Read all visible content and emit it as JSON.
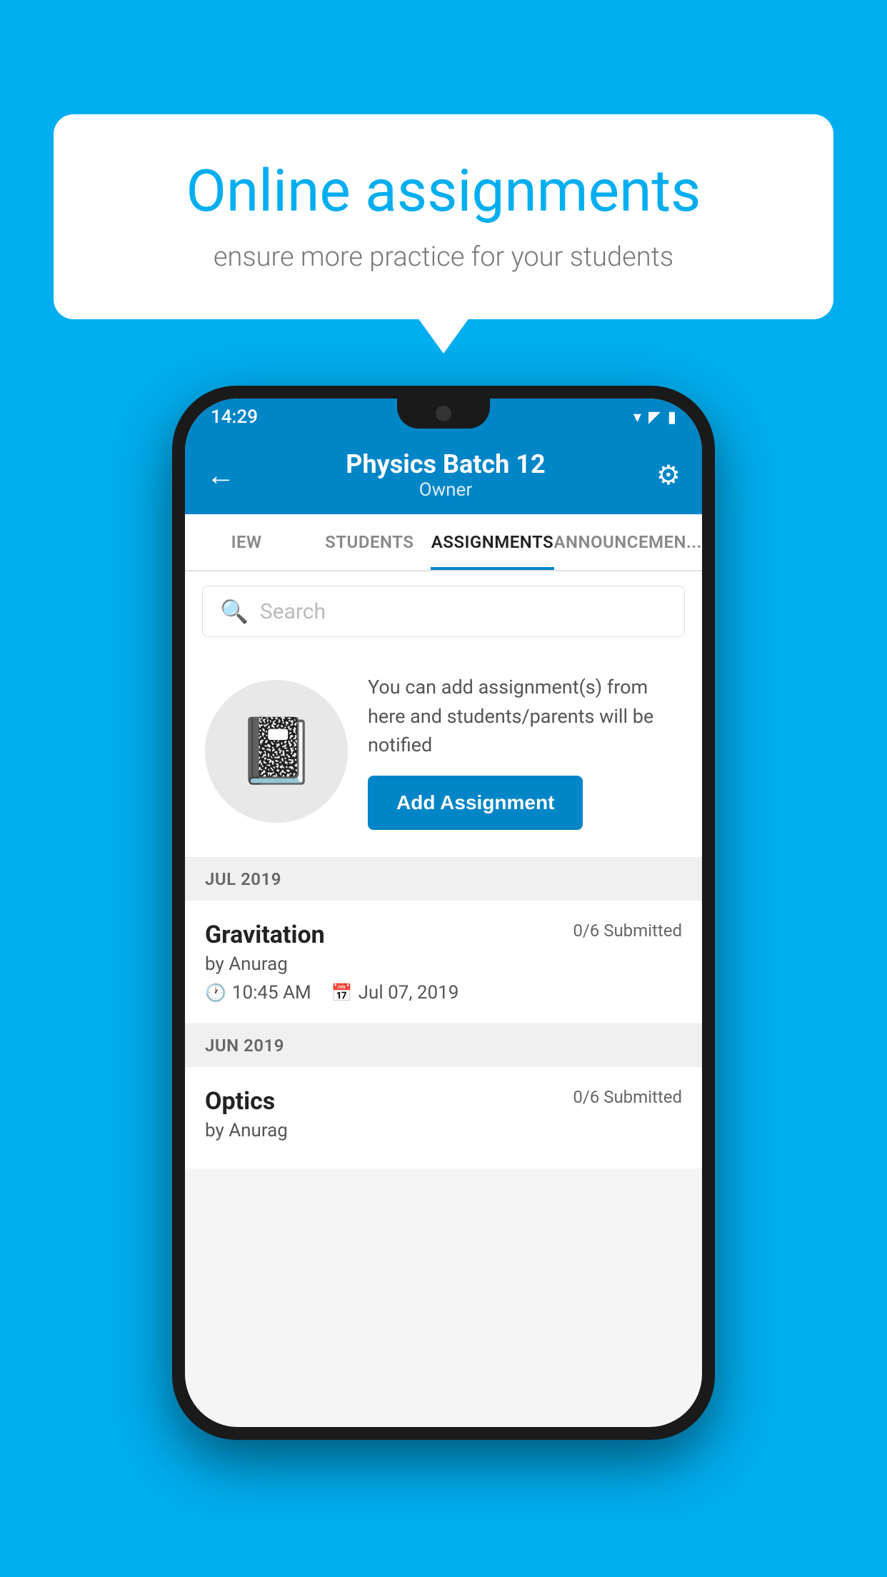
{
  "background_color": "#00AEEF",
  "speech_bubble": {
    "title": "Online assignments",
    "subtitle": "ensure more practice for your students"
  },
  "phone": {
    "status_bar": {
      "time": "14:29",
      "wifi": "▾",
      "signal": "▲",
      "battery": "▮"
    },
    "header": {
      "title": "Physics Batch 12",
      "subtitle": "Owner",
      "back_icon": "←",
      "settings_icon": "⚙"
    },
    "tabs": [
      {
        "label": "IEW",
        "active": false
      },
      {
        "label": "STUDENTS",
        "active": false
      },
      {
        "label": "ASSIGNMENTS",
        "active": true
      },
      {
        "label": "ANNOUNCEMENTS",
        "active": false
      }
    ],
    "search": {
      "placeholder": "Search"
    },
    "promo": {
      "description": "You can add assignment(s) from here and students/parents will be notified",
      "button_label": "Add Assignment"
    },
    "sections": [
      {
        "label": "JUL 2019",
        "assignments": [
          {
            "name": "Gravitation",
            "submitted": "0/6 Submitted",
            "author": "by Anurag",
            "time": "10:45 AM",
            "date": "Jul 07, 2019"
          }
        ]
      },
      {
        "label": "JUN 2019",
        "assignments": [
          {
            "name": "Optics",
            "submitted": "0/6 Submitted",
            "author": "by Anurag",
            "time": "",
            "date": ""
          }
        ]
      }
    ]
  }
}
